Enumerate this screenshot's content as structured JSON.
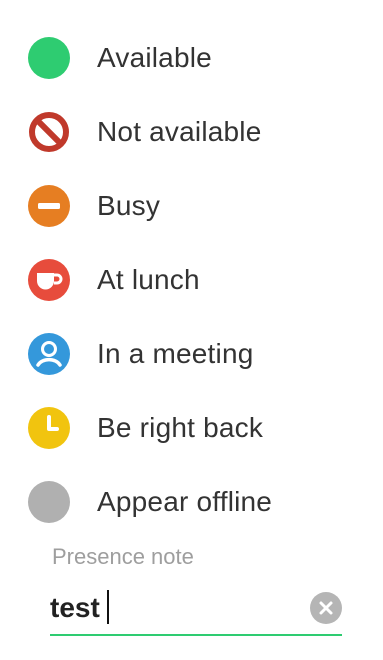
{
  "statuses": [
    {
      "label": "Available",
      "icon": "available-dot-icon",
      "color": "#2ecc71"
    },
    {
      "label": "Not available",
      "icon": "prohibited-icon",
      "color": "#c0392b"
    },
    {
      "label": "Busy",
      "icon": "minus-circle-icon",
      "color": "#e67e22"
    },
    {
      "label": "At lunch",
      "icon": "coffee-cup-icon",
      "color": "#e74c3c"
    },
    {
      "label": "In a meeting",
      "icon": "person-circle-icon",
      "color": "#3498db"
    },
    {
      "label": "Be right back",
      "icon": "clock-icon",
      "color": "#f1c40f"
    },
    {
      "label": "Appear offline",
      "icon": "offline-dot-icon",
      "color": "#b0b0b0"
    }
  ],
  "presence_note": {
    "label": "Presence note",
    "value": "test",
    "underline_color": "#2ecc71",
    "clear_icon": "clear-icon"
  }
}
